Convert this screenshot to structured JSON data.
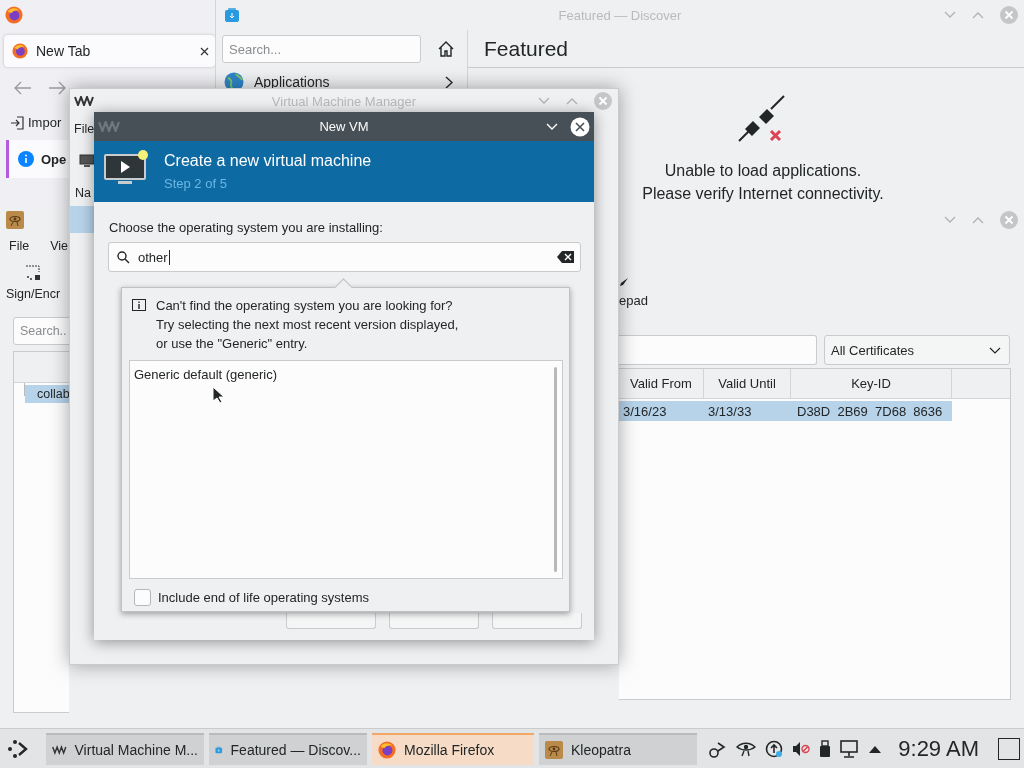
{
  "firefox": {
    "tab": "New Tab",
    "toolbar_item": "Impor",
    "notice": "Ope"
  },
  "discover": {
    "title": "Featured — Discover",
    "search": {
      "placeholder": "Search..."
    },
    "nav_item": "Applications",
    "heading": "Featured",
    "message": [
      "Unable to load applications.",
      "Please verify Internet connectivity."
    ]
  },
  "kleopatra": {
    "menu": [
      "File",
      "Vie"
    ],
    "toolbar": [
      "Sign/Encr",
      "epad"
    ],
    "search": {
      "placeholder": "Search.."
    },
    "filter": "All Certificates",
    "columns": [
      "Valid From",
      "Valid Until",
      "Key-ID"
    ],
    "rows": [
      {
        "name": "collab",
        "valid_from": "3/16/23",
        "valid_until": "3/13/33",
        "key_id": "D38D  2B69  7D68  8636",
        "selected": true
      }
    ]
  },
  "vmm": {
    "title": "Virtual Machine Manager",
    "menu": "File",
    "column": "Na"
  },
  "new_vm": {
    "title": "New VM",
    "heading": "Create a new virtual machine",
    "step": "Step 2 of 5",
    "prompt": "Choose the operating system you are installing:",
    "search": {
      "value": "other"
    },
    "popup": {
      "hint": [
        "Can't find the operating system you are looking for?",
        "Try selecting the next most recent version displayed,",
        "or use the \"Generic\" entry."
      ],
      "items": [
        {
          "label": "Generic default (generic)",
          "selected": false
        }
      ],
      "eol": {
        "label": "Include end of life operating systems",
        "checked": false
      }
    }
  },
  "taskbar": {
    "tasks": [
      {
        "label": "Virtual Machine M...",
        "kind": "vmm",
        "selected": false
      },
      {
        "label": "Featured — Discov...",
        "kind": "discover",
        "selected": false
      },
      {
        "label": "Mozilla Firefox",
        "kind": "firefox",
        "selected": true
      },
      {
        "label": "Kleopatra",
        "kind": "kleopatra",
        "selected": false
      }
    ],
    "clock": "9:29 AM"
  }
}
